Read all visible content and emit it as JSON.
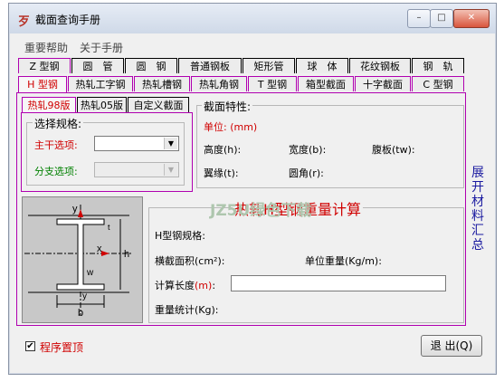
{
  "window": {
    "title": "截面查询手册",
    "icon": "app-logo-icon",
    "min": "–",
    "max": "□",
    "close": "✕"
  },
  "menu": {
    "items": [
      "重要帮助",
      "关于手册"
    ]
  },
  "tabs_row1": [
    "Z 型钢",
    "圆　管",
    "圆　钢",
    "普通钢板",
    "矩形管",
    "球　体",
    "花纹钢板",
    "钢　轨"
  ],
  "tabs_row2": [
    "H 型钢",
    "热轧工字钢",
    "热轧槽钢",
    "热轧角钢",
    "T 型钢",
    "箱型截面",
    "十字截面",
    "C 型钢"
  ],
  "subtabs": [
    "热轧98版",
    "热轧05版",
    "自定义截面"
  ],
  "select_group": {
    "title": "选择规格:",
    "main_label": "主干选项:",
    "main_value": "",
    "branch_label": "分支选项:",
    "branch_value": ""
  },
  "props": {
    "title": "截面特性:",
    "unit": "单位: (mm)",
    "height": "高度(h):",
    "width": "宽度(b):",
    "web": "腹板(tw):",
    "flange": "翼缘(t):",
    "radius": "圆角(r):"
  },
  "calc": {
    "heading": "热轧H型钢重量计算",
    "spec": "H型钢规格:",
    "area": "横截面积(cm²):",
    "unit_weight": "单位重量(Kg/m):",
    "length_pre": "计算长度",
    "length_unit": "(m)",
    "length_sep": ":",
    "length_value": "",
    "total": "重量统计(Kg):"
  },
  "drawing": {
    "y_top": "y",
    "x": "x",
    "h": "h",
    "t": "t",
    "w": "w",
    "b": "b",
    "y_bot": "y"
  },
  "side_link": "展开材料汇总",
  "watermark": "JZ5U绿色下载",
  "footer": {
    "checkbox_label": "程序置顶",
    "checked": "✔",
    "exit_button": "退 出(Q)"
  }
}
